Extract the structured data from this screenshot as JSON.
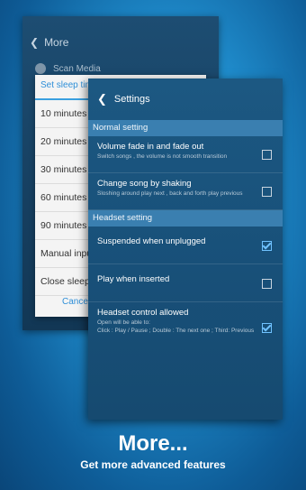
{
  "back_screen": {
    "header": "More",
    "partial_row": "Scan Media"
  },
  "sleep_dialog": {
    "title": "Set sleep timer",
    "items": [
      "10 minutes",
      "20 minutes",
      "30 minutes",
      "60 minutes",
      "90 minutes",
      "Manual input",
      "Close sleep timer"
    ],
    "cancel": "Cancel"
  },
  "settings": {
    "title": "Settings",
    "sections": [
      {
        "header": "Normal setting",
        "rows": [
          {
            "title": "Volume fade in and fade out",
            "subtitle": "Switch songs , the volume is not smooth transition",
            "checked": false
          },
          {
            "title": "Change song by shaking",
            "subtitle": "Sloshing around play next , back and forth play previous",
            "checked": false
          }
        ]
      },
      {
        "header": "Headset setting",
        "rows": [
          {
            "title": "Suspended when unplugged",
            "subtitle": "",
            "checked": true
          },
          {
            "title": "Play when inserted",
            "subtitle": "",
            "checked": false
          },
          {
            "title": "Headset control allowed",
            "subtitle": "Open will be able to:\nClick : Play / Pause ; Double : The next one ; Third: Previous",
            "checked": true
          }
        ]
      }
    ]
  },
  "promo": {
    "title": "More...",
    "subtitle": "Get more advanced features"
  },
  "colors": {
    "accent": "#2f8fd8",
    "section_header": "#3a7fb0",
    "panel": "#185079"
  }
}
